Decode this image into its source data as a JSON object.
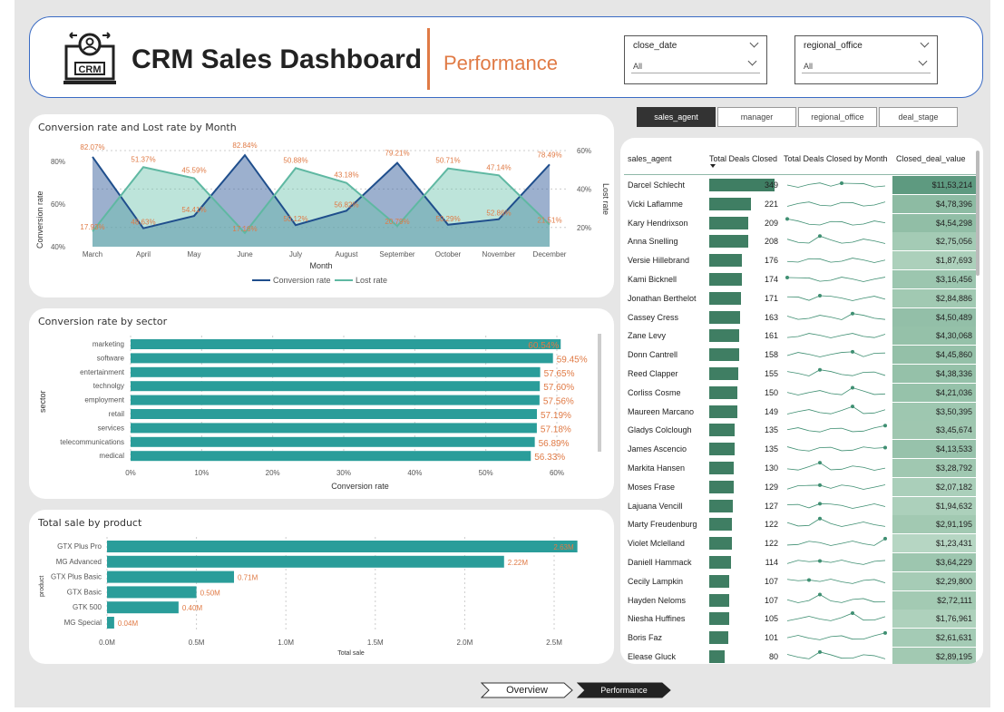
{
  "header": {
    "title": "CRM Sales Dashboard",
    "subtitle": "Performance",
    "logo_text": "CRM"
  },
  "slicers": [
    {
      "label": "close_date",
      "value": "All"
    },
    {
      "label": "regional_office",
      "value": "All"
    }
  ],
  "tabs": [
    {
      "label": "sales_agent",
      "active": true
    },
    {
      "label": "manager",
      "active": false
    },
    {
      "label": "regional_office",
      "active": false
    },
    {
      "label": "deal_stage",
      "active": false
    }
  ],
  "nav": {
    "overview": "Overview",
    "performance": "Performance"
  },
  "charts": {
    "line": {
      "title": "Conversion rate and Lost rate by Month",
      "xlabel": "Month",
      "ylabel_left": "Conversion rate",
      "ylabel_right": "Lost rate",
      "left_ticks": [
        "80%",
        "60%",
        "40%"
      ],
      "right_ticks": [
        "60%",
        "40%",
        "20%"
      ],
      "legend": [
        "Conversion rate",
        "Lost rate"
      ]
    },
    "sector": {
      "title": "Conversion rate by sector",
      "ylabel": "sector",
      "xlabel": "Conversion rate",
      "ticks": [
        "0%",
        "10%",
        "20%",
        "30%",
        "40%",
        "50%",
        "60%"
      ]
    },
    "product": {
      "title": "Total sale by product",
      "ylabel": "product",
      "xlabel": "Total sale",
      "ticks": [
        "0.0M",
        "0.5M",
        "1.0M",
        "1.5M",
        "2.0M",
        "2.5M"
      ]
    }
  },
  "chart_data": [
    {
      "type": "area",
      "title": "Conversion rate and Lost rate by Month",
      "xlabel": "Month",
      "x": [
        "March",
        "April",
        "May",
        "June",
        "July",
        "August",
        "September",
        "October",
        "November",
        "December"
      ],
      "series": [
        {
          "name": "Conversion rate",
          "axis": "left",
          "values": [
            82.07,
            48.63,
            54.41,
            82.84,
            50.12,
            56.82,
            79.21,
            50.29,
            52.86,
            78.49
          ],
          "labels": [
            "82.07%",
            "48.63%",
            "54.41%",
            "82.84%",
            "50.12%",
            "56.82%",
            "79.21%",
            "50.29%",
            "52.86%",
            "78.49%"
          ]
        },
        {
          "name": "Lost rate",
          "axis": "right",
          "values": [
            17.93,
            51.37,
            45.59,
            17.16,
            50.88,
            43.18,
            20.79,
            50.71,
            47.14,
            21.51
          ],
          "labels": [
            "17.93%",
            "51.37%",
            "45.59%",
            "17.16%",
            "50.88%",
            "43.18%",
            "20.79%",
            "50.71%",
            "47.14%",
            "21.51%"
          ]
        }
      ],
      "ylim_left": [
        40,
        85
      ],
      "ylim_right": [
        10,
        60
      ],
      "colors": {
        "conversion": "#1f4e8c",
        "lost": "#5fb8a2"
      }
    },
    {
      "type": "bar",
      "orientation": "horizontal",
      "title": "Conversion rate by sector",
      "xlabel": "Conversion rate",
      "ylabel": "sector",
      "categories": [
        "marketing",
        "software",
        "entertainment",
        "technolgy",
        "employment",
        "retail",
        "services",
        "telecommunications",
        "medical"
      ],
      "values": [
        60.54,
        59.45,
        57.65,
        57.6,
        57.56,
        57.19,
        57.18,
        56.89,
        56.33
      ],
      "labels": [
        "60.54%",
        "59.45%",
        "57.65%",
        "57.60%",
        "57.56%",
        "57.19%",
        "57.18%",
        "56.89%",
        "56.33%"
      ],
      "xlim": [
        0,
        60
      ],
      "color": "#2a9d9a"
    },
    {
      "type": "bar",
      "orientation": "horizontal",
      "title": "Total sale by product",
      "xlabel": "Total sale",
      "ylabel": "product",
      "categories": [
        "GTX Plus Pro",
        "MG Advanced",
        "GTX Plus Basic",
        "GTX Basic",
        "GTK 500",
        "MG Special"
      ],
      "values": [
        2.63,
        2.22,
        0.71,
        0.5,
        0.4,
        0.04
      ],
      "labels": [
        "2.63M",
        "2.22M",
        "0.71M",
        "0.50M",
        "0.40M",
        "0.04M"
      ],
      "xlim": [
        0,
        2.5
      ],
      "color": "#2a9d9a"
    }
  ],
  "table": {
    "columns": [
      "sales_agent",
      "Total Deals Closed",
      "Total Deals Closed by Month",
      "Closed_deal_value"
    ],
    "max_deals": 349,
    "rows": [
      {
        "agent": "Darcel Schlecht",
        "deals": 349,
        "value": "$11,53,214"
      },
      {
        "agent": "Vicki Laflamme",
        "deals": 221,
        "value": "$4,78,396"
      },
      {
        "agent": "Kary Hendrixson",
        "deals": 209,
        "value": "$4,54,298"
      },
      {
        "agent": "Anna Snelling",
        "deals": 208,
        "value": "$2,75,056"
      },
      {
        "agent": "Versie Hillebrand",
        "deals": 176,
        "value": "$1,87,693"
      },
      {
        "agent": "Kami Bicknell",
        "deals": 174,
        "value": "$3,16,456"
      },
      {
        "agent": "Jonathan Berthelot",
        "deals": 171,
        "value": "$2,84,886"
      },
      {
        "agent": "Cassey Cress",
        "deals": 163,
        "value": "$4,50,489"
      },
      {
        "agent": "Zane Levy",
        "deals": 161,
        "value": "$4,30,068"
      },
      {
        "agent": "Donn Cantrell",
        "deals": 158,
        "value": "$4,45,860"
      },
      {
        "agent": "Reed Clapper",
        "deals": 155,
        "value": "$4,38,336"
      },
      {
        "agent": "Corliss Cosme",
        "deals": 150,
        "value": "$4,21,036"
      },
      {
        "agent": "Maureen Marcano",
        "deals": 149,
        "value": "$3,50,395"
      },
      {
        "agent": "Gladys Colclough",
        "deals": 135,
        "value": "$3,45,674"
      },
      {
        "agent": "James Ascencio",
        "deals": 135,
        "value": "$4,13,533"
      },
      {
        "agent": "Markita Hansen",
        "deals": 130,
        "value": "$3,28,792"
      },
      {
        "agent": "Moses Frase",
        "deals": 129,
        "value": "$2,07,182"
      },
      {
        "agent": "Lajuana Vencill",
        "deals": 127,
        "value": "$1,94,632"
      },
      {
        "agent": "Marty Freudenburg",
        "deals": 122,
        "value": "$2,91,195"
      },
      {
        "agent": "Violet Mclelland",
        "deals": 122,
        "value": "$1,23,431"
      },
      {
        "agent": "Daniell Hammack",
        "deals": 114,
        "value": "$3,64,229"
      },
      {
        "agent": "Cecily Lampkin",
        "deals": 107,
        "value": "$2,29,800"
      },
      {
        "agent": "Hayden Neloms",
        "deals": 107,
        "value": "$2,72,111"
      },
      {
        "agent": "Niesha Huffines",
        "deals": 105,
        "value": "$1,76,961"
      },
      {
        "agent": "Boris Faz",
        "deals": 101,
        "value": "$2,61,631"
      },
      {
        "agent": "Elease Gluck",
        "deals": 80,
        "value": "$2,89,195"
      }
    ]
  }
}
